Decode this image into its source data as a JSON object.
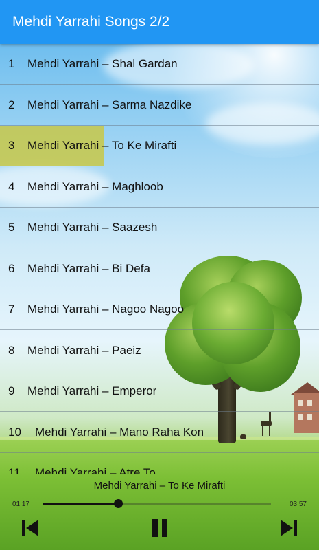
{
  "header": {
    "title": "Mehdi Yarrahi Songs 2/2"
  },
  "songs": [
    {
      "number": "1",
      "title": "Mehdi Yarrahi – Shal Gardan"
    },
    {
      "number": "2",
      "title": "Mehdi Yarrahi – Sarma Nazdike"
    },
    {
      "number": "3",
      "title": "Mehdi Yarrahi – To Ke Mirafti"
    },
    {
      "number": "4",
      "title": "Mehdi Yarrahi – Maghloob"
    },
    {
      "number": "5",
      "title": "Mehdi Yarrahi – Saazesh"
    },
    {
      "number": "6",
      "title": "Mehdi Yarrahi – Bi Defa"
    },
    {
      "number": "7",
      "title": "Mehdi Yarrahi – Nagoo Nagoo"
    },
    {
      "number": "8",
      "title": "Mehdi Yarrahi – Paeiz"
    },
    {
      "number": "9",
      "title": "Mehdi Yarrahi – Emperor"
    },
    {
      "number": "10",
      "title": "Mehdi Yarrahi – Mano Raha Kon"
    },
    {
      "number": "11",
      "title": "Mehdi Yarrahi – Atre To"
    }
  ],
  "selected_index": 2,
  "player": {
    "now_playing": "Mehdi Yarrahi – To Ke Mirafti",
    "current_time": "01:17",
    "total_time": "03:57",
    "progress": 0.33,
    "prev_icon": "skip-previous-icon",
    "pause_icon": "pause-icon",
    "next_icon": "skip-next-icon"
  },
  "colors": {
    "header": "#2196f3",
    "highlight": "#c8c846"
  }
}
